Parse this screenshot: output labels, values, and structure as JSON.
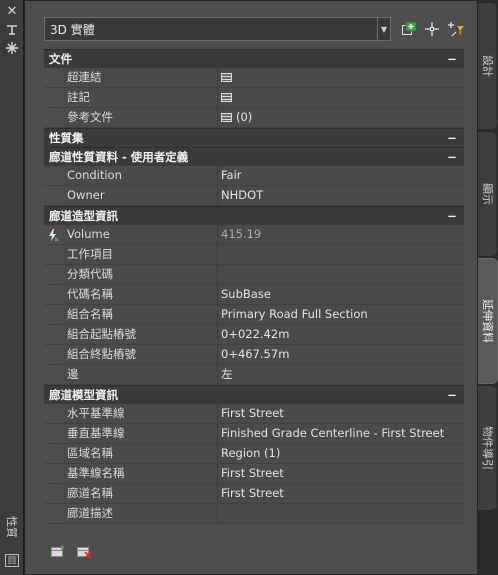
{
  "palette": {
    "title": "性質"
  },
  "toolbar": {
    "object_type": "3D 實體",
    "buttons": [
      {
        "name": "toggle-pickadd-button",
        "icon": "pickadd-icon"
      },
      {
        "name": "select-objects-button",
        "icon": "crosshair-icon"
      },
      {
        "name": "quick-select-button",
        "icon": "quick-select-icon"
      }
    ]
  },
  "categories": [
    {
      "title": "文件",
      "collapse": "−",
      "rows": [
        {
          "name": "超連結",
          "value": "",
          "icon": "table-icon"
        },
        {
          "name": "註記",
          "value": "",
          "icon": "table-icon"
        },
        {
          "name": "參考文件",
          "value": "(0)",
          "icon": "table-icon"
        }
      ]
    },
    {
      "title": "性質集",
      "collapse": "−",
      "rows": []
    },
    {
      "title": "廊道性質資料 - 使用者定義",
      "collapse": "−",
      "rows": [
        {
          "name": "Condition",
          "value": "Fair"
        },
        {
          "name": "Owner",
          "value": "NHDOT"
        }
      ]
    },
    {
      "title": "廊道造型資訊",
      "collapse": "−",
      "rows": [
        {
          "name": "Volume",
          "value": "415.19",
          "readonly": true,
          "icon_left": "auto-calc-icon"
        },
        {
          "name": "工作項目",
          "value": ""
        },
        {
          "name": "分類代碼",
          "value": ""
        },
        {
          "name": "代碼名稱",
          "value": "SubBase"
        },
        {
          "name": "組合名稱",
          "value": "Primary Road Full Section"
        },
        {
          "name": "組合起點樁號",
          "value": "0+022.42m"
        },
        {
          "name": "組合終點樁號",
          "value": "0+467.57m"
        },
        {
          "name": "邊",
          "value": "左"
        }
      ]
    },
    {
      "title": "廊道模型資訊",
      "collapse": "−",
      "rows": [
        {
          "name": "水平基準線",
          "value": "First Street"
        },
        {
          "name": "垂直基準線",
          "value": "Finished Grade Centerline - First Street"
        },
        {
          "name": "區域名稱",
          "value": "Region (1)"
        },
        {
          "name": "基準線名稱",
          "value": "First Street"
        },
        {
          "name": "廊道名稱",
          "value": "First Street"
        },
        {
          "name": "廊道描述",
          "value": ""
        }
      ]
    }
  ],
  "right_tabs": [
    {
      "label": "設計",
      "active": false
    },
    {
      "label": "顯示",
      "active": false
    },
    {
      "label": "延伸資料",
      "active": true
    },
    {
      "label": "物件導引",
      "active": false
    }
  ],
  "colors": {
    "panel": "#4e4e4e",
    "category": "#3b3b3b",
    "strip": "#3c3c3c",
    "active_tab": "#5a5a5a"
  }
}
